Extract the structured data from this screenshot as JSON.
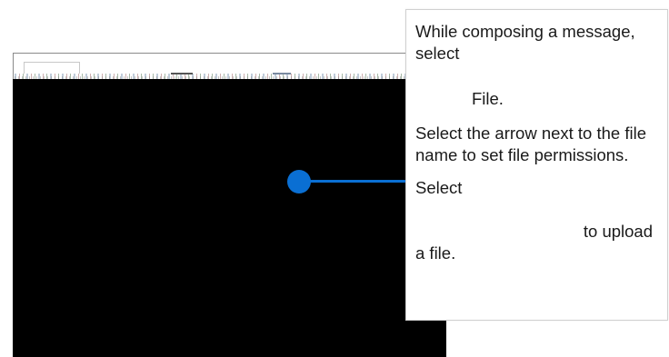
{
  "tooltip": {
    "step1_line": "While composing a message, select",
    "step1_file": "File.",
    "step2": "Select the arrow next to the file name to set file permissions.",
    "step3_prefix": "Select",
    "step3_suffix": "to upload",
    "step3_end": "a file."
  },
  "colors": {
    "callout": "#0a6fd3",
    "screenshot_background": "#000000",
    "tooltip_background": "#ffffff",
    "text": "#1a1a1a"
  },
  "icons": {
    "callout_marker": "callout-dot-icon"
  }
}
